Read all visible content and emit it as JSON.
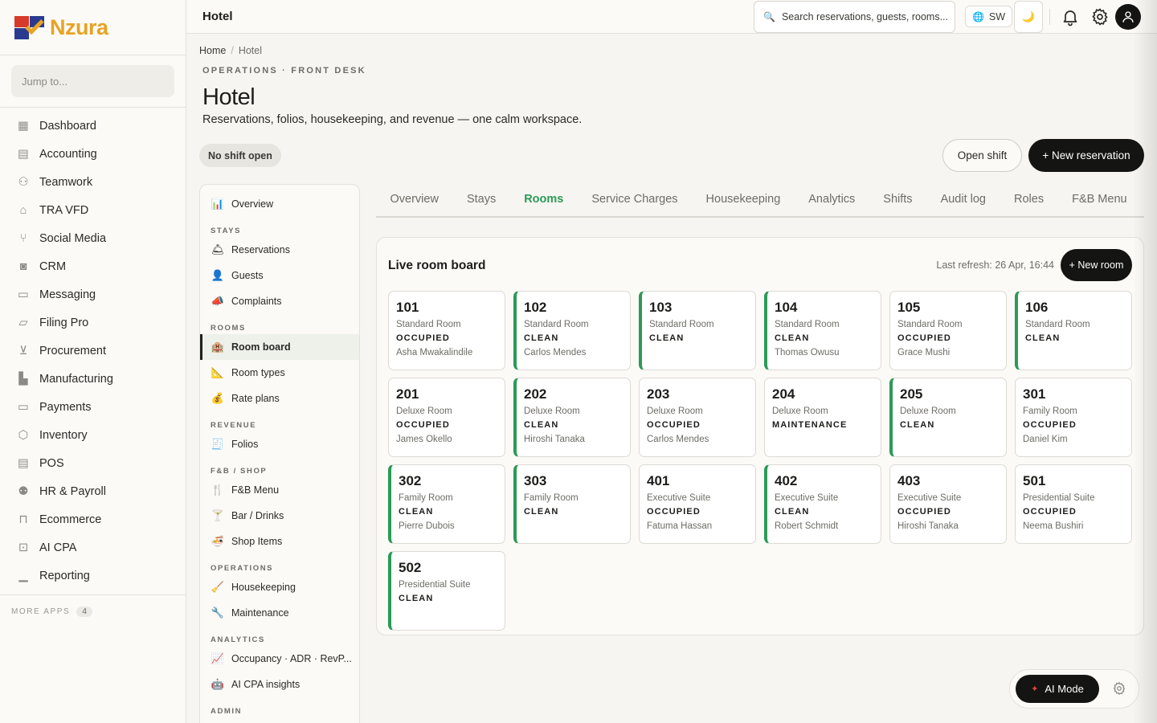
{
  "brand": {
    "name": "Nzura"
  },
  "sidebar": {
    "jump_placeholder": "Jump to...",
    "items": [
      {
        "label": "Dashboard",
        "icon": "grid-icon",
        "glyph": "▦"
      },
      {
        "label": "Accounting",
        "icon": "ledger-icon",
        "glyph": "▤"
      },
      {
        "label": "Teamwork",
        "icon": "people-icon",
        "glyph": "⚇"
      },
      {
        "label": "TRA VFD",
        "icon": "bank-icon",
        "glyph": "⌂"
      },
      {
        "label": "Social Media",
        "icon": "share-icon",
        "glyph": "⑂"
      },
      {
        "label": "CRM",
        "icon": "contact-card-icon",
        "glyph": "◙"
      },
      {
        "label": "Messaging",
        "icon": "chat-icon",
        "glyph": "▭"
      },
      {
        "label": "Filing Pro",
        "icon": "folder-icon",
        "glyph": "▱"
      },
      {
        "label": "Procurement",
        "icon": "cart-icon",
        "glyph": "⊻"
      },
      {
        "label": "Manufacturing",
        "icon": "factory-icon",
        "glyph": "▙"
      },
      {
        "label": "Payments",
        "icon": "credit-card-icon",
        "glyph": "▭"
      },
      {
        "label": "Inventory",
        "icon": "box-icon",
        "glyph": "⬡"
      },
      {
        "label": "POS",
        "icon": "receipt-icon",
        "glyph": "▤"
      },
      {
        "label": "HR & Payroll",
        "icon": "user-x-icon",
        "glyph": "⚉"
      },
      {
        "label": "Ecommerce",
        "icon": "bag-icon",
        "glyph": "⊓"
      },
      {
        "label": "AI CPA",
        "icon": "robot-icon",
        "glyph": "⊡"
      },
      {
        "label": "Reporting",
        "icon": "bar-chart-icon",
        "glyph": "▁"
      }
    ],
    "more_apps_label": "MORE APPS",
    "more_apps_count": "4"
  },
  "topbar": {
    "title": "Hotel",
    "search_placeholder": "Search reservations, guests, rooms...",
    "lang": "SW",
    "theme_glyph": "🌙"
  },
  "page": {
    "breadcrumb_home": "Home",
    "breadcrumb_sep": "/",
    "breadcrumb_current": "Hotel",
    "eyebrow": "OPERATIONS · FRONT DESK",
    "title": "Hotel",
    "subtitle": "Reservations, folios, housekeeping, and revenue — one calm workspace.",
    "shift_status": "No shift open",
    "open_shift_label": "Open shift",
    "new_reservation_label": "+ New reservation"
  },
  "module_nav": [
    {
      "kind": "item",
      "label": "Overview",
      "glyph": "📊",
      "icon": "overview-chart-icon"
    },
    {
      "kind": "group",
      "label": "STAYS"
    },
    {
      "kind": "item",
      "label": "Reservations",
      "glyph": "🛎",
      "icon": "bell-hop-icon"
    },
    {
      "kind": "item",
      "label": "Guests",
      "glyph": "👤",
      "icon": "guest-icon"
    },
    {
      "kind": "item",
      "label": "Complaints",
      "glyph": "📣",
      "icon": "megaphone-icon"
    },
    {
      "kind": "group",
      "label": "ROOMS"
    },
    {
      "kind": "item",
      "label": "Room board",
      "glyph": "🏨",
      "icon": "hotel-icon",
      "active": true
    },
    {
      "kind": "item",
      "label": "Room types",
      "glyph": "📐",
      "icon": "ruler-icon"
    },
    {
      "kind": "item",
      "label": "Rate plans",
      "glyph": "💰",
      "icon": "money-bag-icon"
    },
    {
      "kind": "group",
      "label": "REVENUE"
    },
    {
      "kind": "item",
      "label": "Folios",
      "glyph": "🧾",
      "icon": "receipt-icon"
    },
    {
      "kind": "group",
      "label": "F&B / SHOP"
    },
    {
      "kind": "item",
      "label": "F&B Menu",
      "glyph": "🍴",
      "icon": "cutlery-icon"
    },
    {
      "kind": "item",
      "label": "Bar / Drinks",
      "glyph": "🍸",
      "icon": "cocktail-icon"
    },
    {
      "kind": "item",
      "label": "Shop Items",
      "glyph": "🍜",
      "icon": "bowl-icon"
    },
    {
      "kind": "group",
      "label": "OPERATIONS"
    },
    {
      "kind": "item",
      "label": "Housekeeping",
      "glyph": "🧹",
      "icon": "broom-icon"
    },
    {
      "kind": "item",
      "label": "Maintenance",
      "glyph": "🔧",
      "icon": "wrench-icon"
    },
    {
      "kind": "group",
      "label": "ANALYTICS"
    },
    {
      "kind": "item",
      "label": "Occupancy · ADR · RevP...",
      "glyph": "📈",
      "icon": "trend-icon"
    },
    {
      "kind": "item",
      "label": "AI CPA insights",
      "glyph": "🤖",
      "icon": "robot-icon"
    },
    {
      "kind": "group",
      "label": "ADMIN"
    }
  ],
  "tabs": [
    {
      "label": "Overview"
    },
    {
      "label": "Stays"
    },
    {
      "label": "Rooms",
      "active": true
    },
    {
      "label": "Service Charges"
    },
    {
      "label": "Housekeeping"
    },
    {
      "label": "Analytics"
    },
    {
      "label": "Shifts"
    },
    {
      "label": "Audit log"
    },
    {
      "label": "Roles"
    },
    {
      "label": "F&B Menu"
    }
  ],
  "board": {
    "title": "Live room board",
    "last_refresh": "Last refresh: 26 Apr, 16:44",
    "new_room_label": "+ New room",
    "accent_clean": "#2c9a57",
    "rooms": [
      {
        "number": "101",
        "type": "Standard Room",
        "status": "OCCUPIED",
        "guest": "Asha Mwakalindile"
      },
      {
        "number": "102",
        "type": "Standard Room",
        "status": "CLEAN",
        "guest": "Carlos Mendes"
      },
      {
        "number": "103",
        "type": "Standard Room",
        "status": "CLEAN",
        "guest": ""
      },
      {
        "number": "104",
        "type": "Standard Room",
        "status": "CLEAN",
        "guest": "Thomas Owusu"
      },
      {
        "number": "105",
        "type": "Standard Room",
        "status": "OCCUPIED",
        "guest": "Grace Mushi"
      },
      {
        "number": "106",
        "type": "Standard Room",
        "status": "CLEAN",
        "guest": ""
      },
      {
        "number": "201",
        "type": "Deluxe Room",
        "status": "OCCUPIED",
        "guest": "James Okello"
      },
      {
        "number": "202",
        "type": "Deluxe Room",
        "status": "CLEAN",
        "guest": "Hiroshi Tanaka"
      },
      {
        "number": "203",
        "type": "Deluxe Room",
        "status": "OCCUPIED",
        "guest": "Carlos Mendes"
      },
      {
        "number": "204",
        "type": "Deluxe Room",
        "status": "MAINTENANCE",
        "guest": ""
      },
      {
        "number": "205",
        "type": "Deluxe Room",
        "status": "CLEAN",
        "guest": ""
      },
      {
        "number": "301",
        "type": "Family Room",
        "status": "OCCUPIED",
        "guest": "Daniel Kim"
      },
      {
        "number": "302",
        "type": "Family Room",
        "status": "CLEAN",
        "guest": "Pierre Dubois"
      },
      {
        "number": "303",
        "type": "Family Room",
        "status": "CLEAN",
        "guest": ""
      },
      {
        "number": "401",
        "type": "Executive Suite",
        "status": "OCCUPIED",
        "guest": "Fatuma Hassan"
      },
      {
        "number": "402",
        "type": "Executive Suite",
        "status": "CLEAN",
        "guest": "Robert Schmidt"
      },
      {
        "number": "403",
        "type": "Executive Suite",
        "status": "OCCUPIED",
        "guest": "Hiroshi Tanaka"
      },
      {
        "number": "501",
        "type": "Presidential Suite",
        "status": "OCCUPIED",
        "guest": "Neema Bushiri"
      },
      {
        "number": "502",
        "type": "Presidential Suite",
        "status": "CLEAN",
        "guest": ""
      }
    ]
  },
  "ai_dock": {
    "label": "AI Mode",
    "spark_glyph": "✦"
  }
}
